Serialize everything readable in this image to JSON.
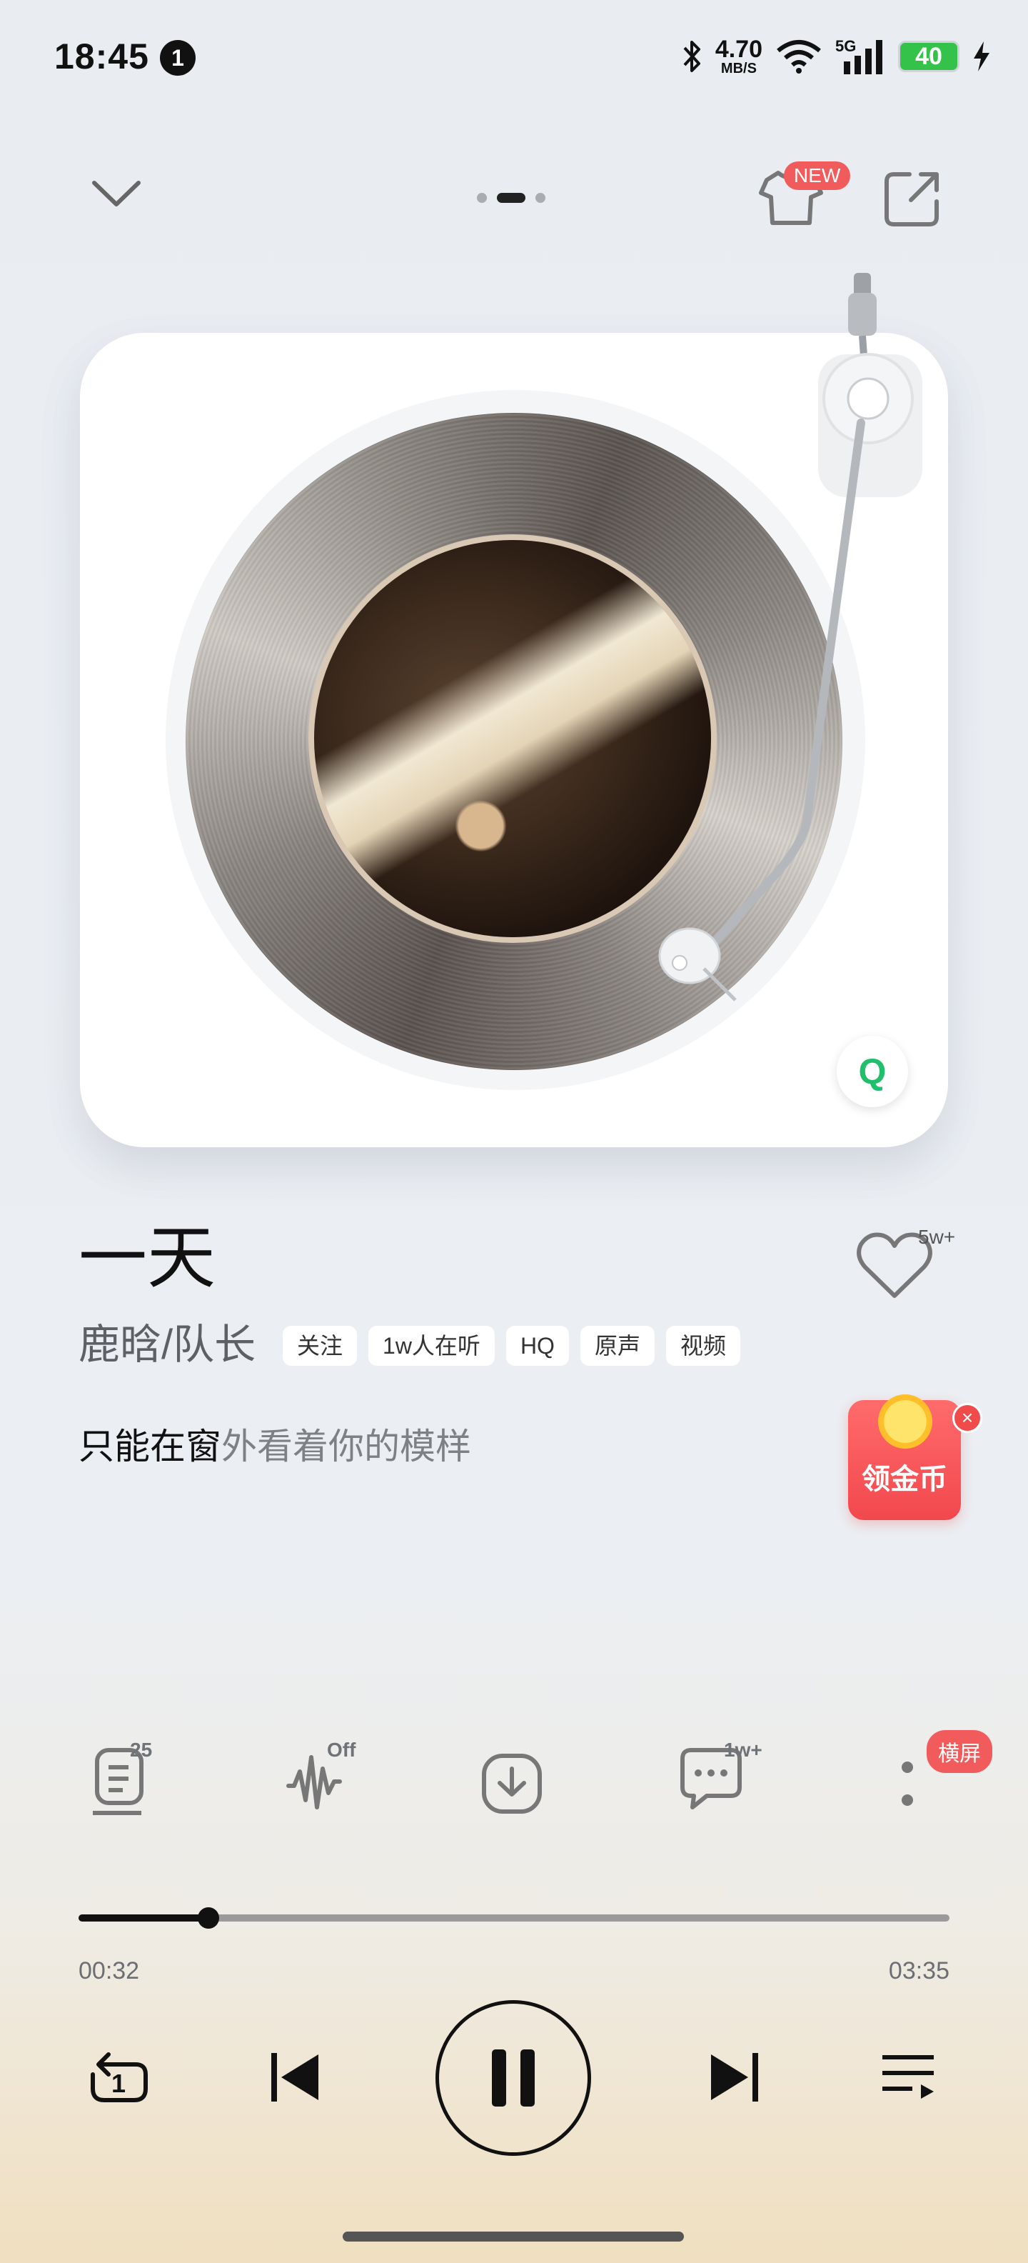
{
  "status_bar": {
    "time": "18:45",
    "notification_count": "1",
    "net_speed_value": "4.70",
    "net_speed_unit": "MB/S",
    "cell_label": "5G",
    "battery": "40"
  },
  "header": {
    "new_badge": "NEW",
    "page_dots": 3,
    "active_page": 2
  },
  "player": {
    "logo_letter": "Q"
  },
  "song": {
    "title": "一天",
    "artist": "鹿晗/队长",
    "like_count": "5w+",
    "tags": [
      "关注",
      "1w人在听",
      "HQ",
      "原声",
      "视频"
    ],
    "lyric_sung": "只能在窗",
    "lyric_rest": "外看着你的模样"
  },
  "promo": {
    "envelope_label": "领金币",
    "close_symbol": "×"
  },
  "functions": {
    "playlist_count": "25",
    "effect_state": "Off",
    "comment_count": "1w+",
    "landscape_label": "横屏"
  },
  "progress": {
    "current": "00:32",
    "total": "03:35",
    "fraction": 0.149
  },
  "playback": {
    "repeat_count": "1"
  },
  "colors": {
    "accent_red": "#f25b5b",
    "qq_green": "#1fbf6c"
  }
}
